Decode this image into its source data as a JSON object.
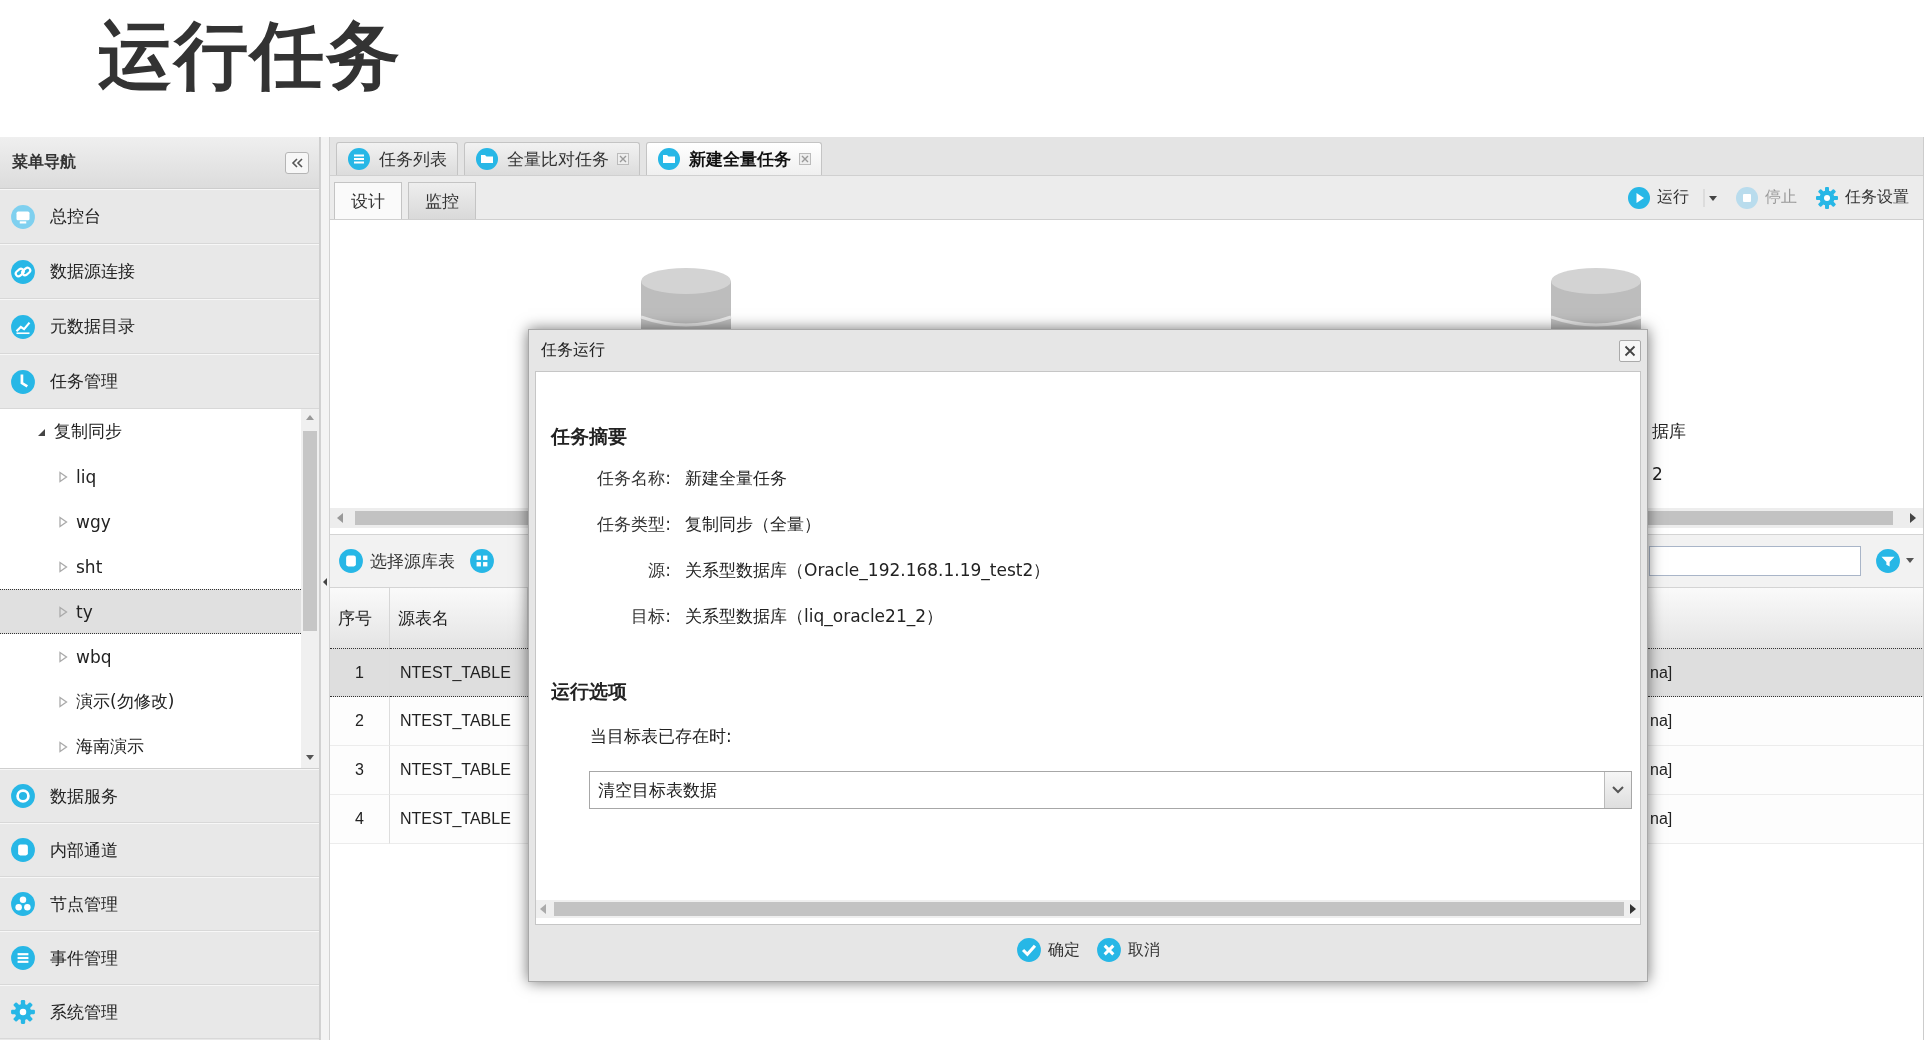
{
  "page_title": "运行任务",
  "sidebar": {
    "title": "菜单导航",
    "items": [
      {
        "label": "总控台"
      },
      {
        "label": "数据源连接"
      },
      {
        "label": "元数据目录"
      },
      {
        "label": "任务管理",
        "children": [
          {
            "label": "复制同步",
            "expanded": true,
            "selected": false,
            "children": [
              {
                "label": "liq",
                "expanded": false,
                "selected": false
              },
              {
                "label": "wgy",
                "expanded": false,
                "selected": false
              },
              {
                "label": "sht",
                "expanded": false,
                "selected": false
              },
              {
                "label": "ty",
                "expanded": false,
                "selected": true
              },
              {
                "label": "wbq",
                "expanded": false,
                "selected": false
              },
              {
                "label": "演示(勿修改)",
                "expanded": false,
                "selected": false
              },
              {
                "label": "海南演示",
                "expanded": false,
                "selected": false
              }
            ]
          }
        ]
      },
      {
        "label": "数据服务"
      },
      {
        "label": "内部通道"
      },
      {
        "label": "节点管理"
      },
      {
        "label": "事件管理"
      },
      {
        "label": "系统管理"
      }
    ]
  },
  "tabs": [
    {
      "label": "任务列表",
      "selected": false,
      "closable": false
    },
    {
      "label": "全量比对任务",
      "selected": false,
      "closable": true
    },
    {
      "label": "新建全量任务",
      "selected": true,
      "closable": true
    }
  ],
  "subtabs": [
    {
      "label": "设计",
      "selected": true
    },
    {
      "label": "监控",
      "selected": false
    }
  ],
  "toolbar": [
    {
      "label": "运行",
      "kind": "run",
      "disabled": false,
      "dropdown": true
    },
    {
      "label": "停止",
      "kind": "stop",
      "disabled": true,
      "dropdown": false
    },
    {
      "label": "任务设置",
      "kind": "settings",
      "disabled": false,
      "dropdown": false
    }
  ],
  "canvas": {
    "nodes": [
      {
        "kind": "database"
      },
      {
        "kind": "database",
        "lines": [
          "据库",
          "2"
        ]
      }
    ]
  },
  "table_toolbar": {
    "buttons": [
      {
        "kind": "select",
        "label": "选择源库表"
      },
      {
        "kind": "grid"
      }
    ]
  },
  "table": {
    "columns": [
      "序号",
      "源表名"
    ],
    "rows": [
      {
        "selected": true,
        "cells": [
          "1",
          "NTEST_TABLE",
          "na]"
        ]
      },
      {
        "selected": false,
        "cells": [
          "2",
          "NTEST_TABLE",
          "na]"
        ]
      },
      {
        "selected": false,
        "cells": [
          "3",
          "NTEST_TABLE",
          "na]"
        ]
      },
      {
        "selected": false,
        "cells": [
          "4",
          "NTEST_TABLE",
          "na]"
        ]
      }
    ]
  },
  "dialog": {
    "title": "任务运行",
    "summary": {
      "heading": "任务摘要",
      "fields": [
        {
          "label": "任务名称:",
          "value": "新建全量任务"
        },
        {
          "label": "任务类型:",
          "value": "复制同步（全量）"
        },
        {
          "label": "源:",
          "value": "关系型数据库（Oracle_192.168.1.19_test2）"
        },
        {
          "label": "目标:",
          "value": "关系型数据库（liq_oracle21_2）"
        }
      ]
    },
    "options": {
      "heading": "运行选项",
      "label": "当目标表已存在时:",
      "select_value": "清空目标表数据"
    },
    "buttons": [
      {
        "label": "确定",
        "kind": "confirm"
      },
      {
        "label": "取消",
        "kind": "cancel"
      }
    ]
  }
}
